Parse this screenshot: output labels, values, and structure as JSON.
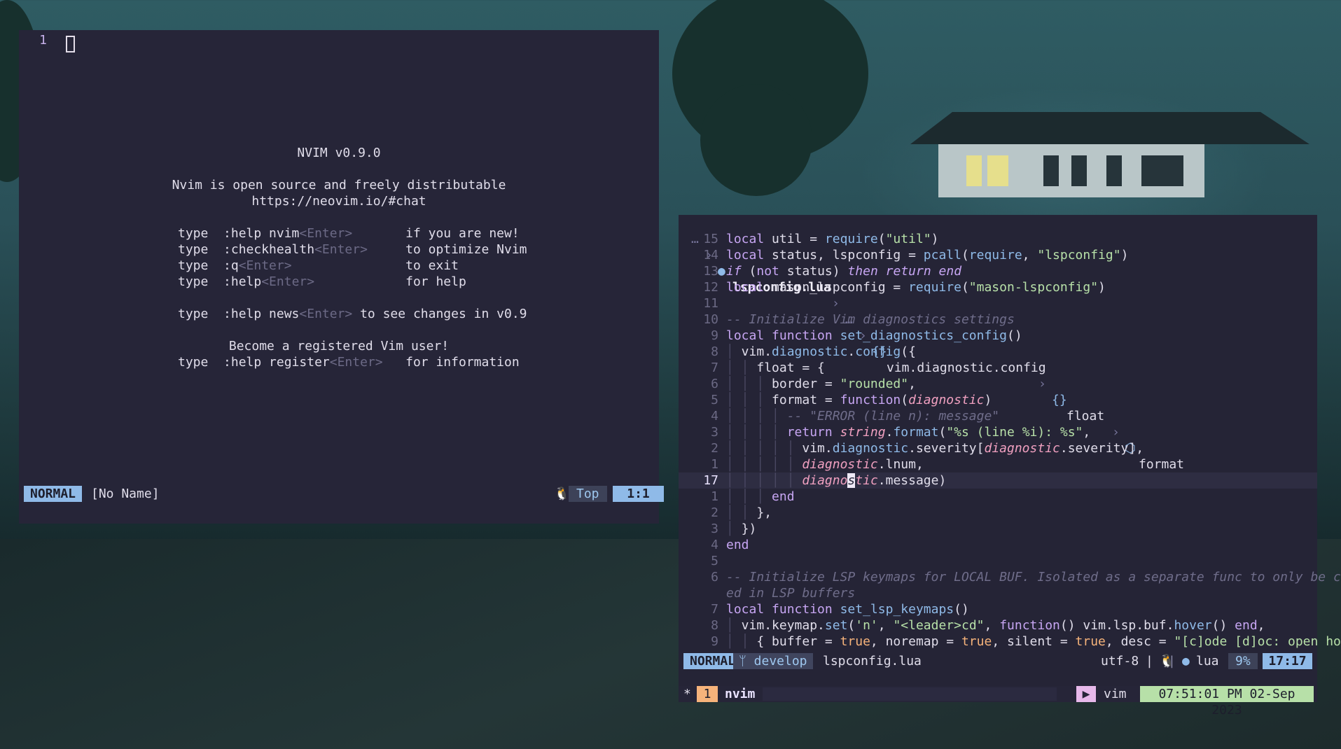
{
  "left": {
    "line_number": "1",
    "splash": [
      {
        "a": "",
        "b": "",
        "c": "NVIM v0.9.0",
        "center": true
      },
      {
        "a": "",
        "b": "",
        "c": "",
        "center": true
      },
      {
        "a": "",
        "b": "",
        "c": "Nvim is open source and freely distributable",
        "center": true
      },
      {
        "a": "",
        "b": "",
        "c": "https://neovim.io/#chat",
        "center": true
      },
      {
        "a": "",
        "b": "",
        "c": "",
        "center": true
      },
      {
        "a": "type  :help nvim",
        "b": "<Enter>",
        "c": "       if you are new!"
      },
      {
        "a": "type  :checkhealth",
        "b": "<Enter>",
        "c": "     to optimize Nvim"
      },
      {
        "a": "type  :q",
        "b": "<Enter>",
        "c": "               to exit"
      },
      {
        "a": "type  :help",
        "b": "<Enter>",
        "c": "            for help"
      },
      {
        "a": "",
        "b": "",
        "c": "",
        "center": true
      },
      {
        "a": "type  :help news",
        "b": "<Enter>",
        "c": " to see changes in v0.9"
      },
      {
        "a": "",
        "b": "",
        "c": "",
        "center": true
      },
      {
        "a": "",
        "b": "",
        "c": "Become a registered Vim user!",
        "center": true
      },
      {
        "a": "type  :help register",
        "b": "<Enter>",
        "c": "   for information"
      }
    ],
    "status": {
      "mode": "NORMAL",
      "file": "[No Name]",
      "position_label": "Top",
      "cursor": "1:1"
    }
  },
  "right": {
    "winbar": {
      "ellipsis1": "…",
      "file": "lspconfig.lua",
      "ellipsis2": "…",
      "ctx1": "vim.diagnostic.config",
      "ctx2": "float",
      "ctx3": "format"
    },
    "status": {
      "mode": "NORMAL",
      "branch": "develop",
      "file": "lspconfig.lua",
      "encoding": "utf-8",
      "separator": "|",
      "filetype": "lua",
      "percent": "9%",
      "cursor": "17:17"
    }
  },
  "tmux": {
    "star": "*",
    "index": "1",
    "window": "nvim",
    "process": "vim",
    "clock": "07:51:01 PM 02-Sep 2023"
  },
  "colors": {
    "accent": "#8fbae8",
    "keyword": "#c7a6f3",
    "string": "#b7e0a8",
    "parameter": "#f0a0c0",
    "orange": "#f6b37b",
    "background": "#262538"
  }
}
